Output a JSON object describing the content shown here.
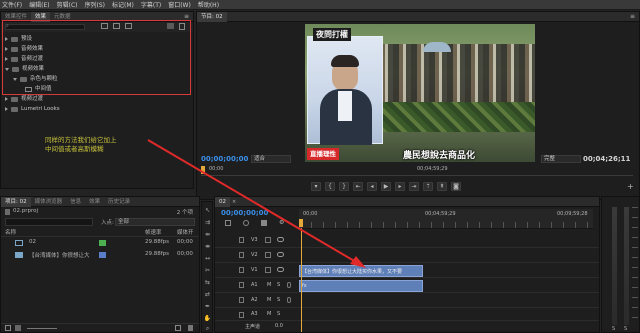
{
  "menu": [
    "文件(F)",
    "编辑(E)",
    "剪辑(C)",
    "序列(S)",
    "标记(M)",
    "字幕(T)",
    "窗口(W)",
    "帮助(H)"
  ],
  "effects_panel": {
    "tabs": [
      "效果控件",
      "效果",
      "元数据"
    ],
    "tree": [
      "预设",
      "音频效果",
      "音频过渡",
      "视频效果",
      "杂色与颗粒",
      "中间值",
      "视频过渡",
      "Lumetri Looks"
    ]
  },
  "annotation": {
    "line1": "同样的方法我们给它加上",
    "line2": "中间值或者高斯模糊",
    "color": "#c8c23c"
  },
  "program_monitor": {
    "tab": "节目: 02",
    "video_title_badge": "夜問打權",
    "video_subtitle": "農民想說去商品化",
    "video_bottom_badge": "直播理性",
    "timecode_left": "00;00;00;00",
    "fit_label": "适合",
    "quality_label": "完整",
    "timecode_right": "00;04;26;11",
    "time_markers": [
      "00;00",
      "00;04;59;29"
    ]
  },
  "project_panel": {
    "tabs": [
      "项目: 02",
      "媒体浏览器",
      "信息",
      "效果",
      "历史记录"
    ],
    "project_file": "02.prproj",
    "item_count": "2 个项",
    "inpoint_label": "入点:",
    "inpoint_value": "全部",
    "col_name": "名称",
    "col_fps": "帧速率",
    "col_media": "媒体开",
    "items": [
      {
        "name": "02",
        "color": "#4caf50",
        "fps": "29.88fps",
        "media": "00;00"
      },
      {
        "name": "【台湾媒体】你很想让大",
        "color": "#5a7fc8",
        "fps": "29.88fps",
        "media": "00;00"
      }
    ]
  },
  "timeline": {
    "tab": "02",
    "timecode": "00;00;00;00",
    "ruler": [
      "00;00",
      "00;04;59;29",
      "00;09;59;28"
    ],
    "video_tracks": [
      "V3",
      "V2",
      "V1"
    ],
    "audio_tracks": [
      "A1",
      "A2",
      "A3"
    ],
    "track_controls": {
      "mute": "M",
      "solo": "S"
    },
    "master_label": "主声道",
    "master_value": "0.0",
    "clip_v1": "【台湾媒体】你很想让大陆买你水果，又不要",
    "clip_a1": "fx",
    "clip_color": "#5f7fb8"
  },
  "arrow_color": "#e02a2a",
  "highlight_color": "#d83a3a"
}
